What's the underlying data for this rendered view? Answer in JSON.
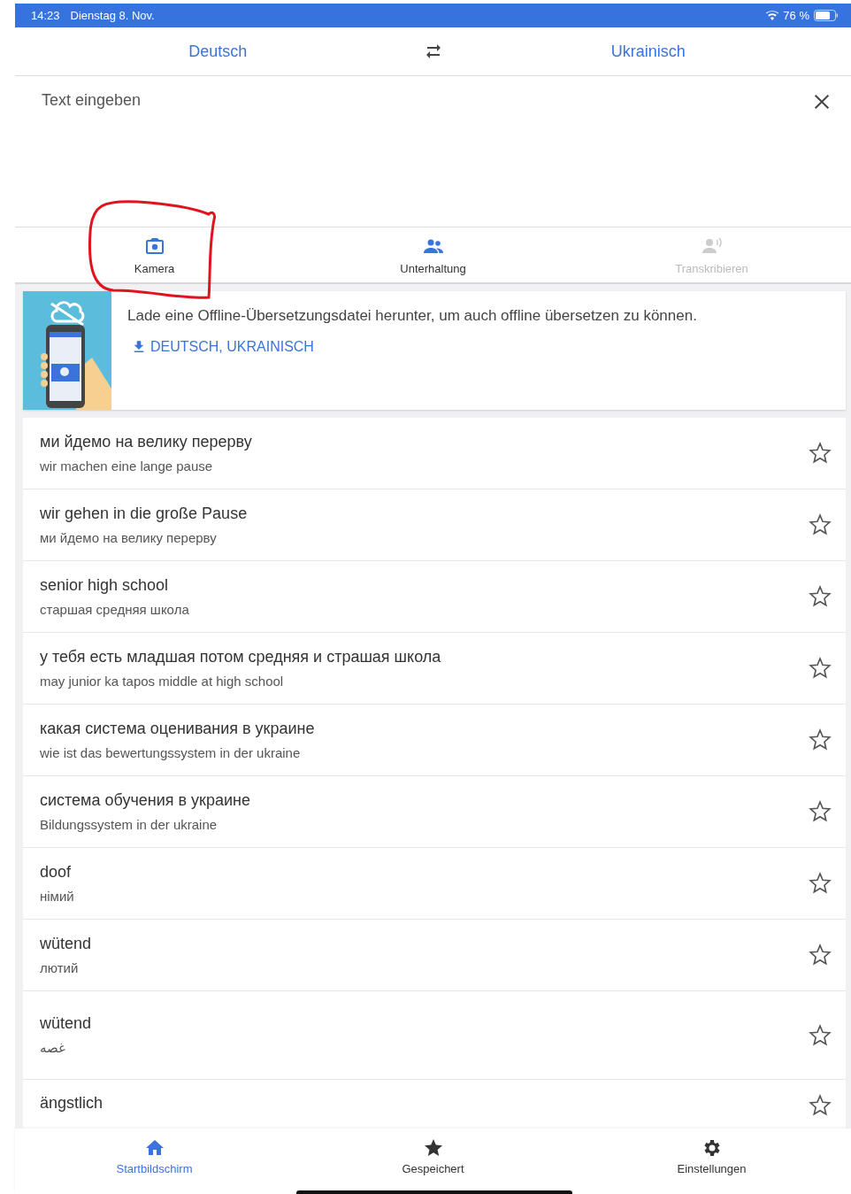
{
  "status_bar": {
    "time": "14:23",
    "date": "Dienstag 8. Nov.",
    "battery": "76 %"
  },
  "languages": {
    "source": "Deutsch",
    "target": "Ukrainisch"
  },
  "input": {
    "placeholder": "Text eingeben"
  },
  "modes": [
    {
      "label": "Kamera",
      "disabled": false
    },
    {
      "label": "Unterhaltung",
      "disabled": false
    },
    {
      "label": "Transkribieren",
      "disabled": true
    }
  ],
  "offline_banner": {
    "text": "Lade eine Offline-Übersetzungsdatei herunter, um auch offline übersetzen zu können.",
    "download": "DEUTSCH, UKRAINISCH"
  },
  "history": [
    {
      "source": "ми йдемо на велику перерву",
      "translation": "wir machen eine lange pause",
      "saved": false
    },
    {
      "source": "wir gehen in die große Pause",
      "translation": "ми йдемо на велику перерву",
      "saved": false
    },
    {
      "source": "senior high school",
      "translation": "старшая средняя школа",
      "saved": false
    },
    {
      "source": "у тебя есть младшая потом средняя и страшая школа",
      "translation": "may junior ka tapos middle at high school",
      "saved": false
    },
    {
      "source": "какая система оценивания в украине",
      "translation": "wie ist das bewertungssystem in der ukraine",
      "saved": false
    },
    {
      "source": "система обучения в украине",
      "translation": "Bildungssystem in der ukraine",
      "saved": false
    },
    {
      "source": "doof",
      "translation": "німий",
      "saved": false
    },
    {
      "source": "wütend",
      "translation": "лютий",
      "saved": false
    },
    {
      "source": "wütend",
      "translation": "غصه",
      "saved": false
    },
    {
      "source": "ängstlich",
      "saved": false
    }
  ],
  "bottom_nav": [
    {
      "label": "Startbildschirm",
      "selected": true
    },
    {
      "label": "Gespeichert",
      "selected": false
    },
    {
      "label": "Einstellungen",
      "selected": false
    }
  ]
}
